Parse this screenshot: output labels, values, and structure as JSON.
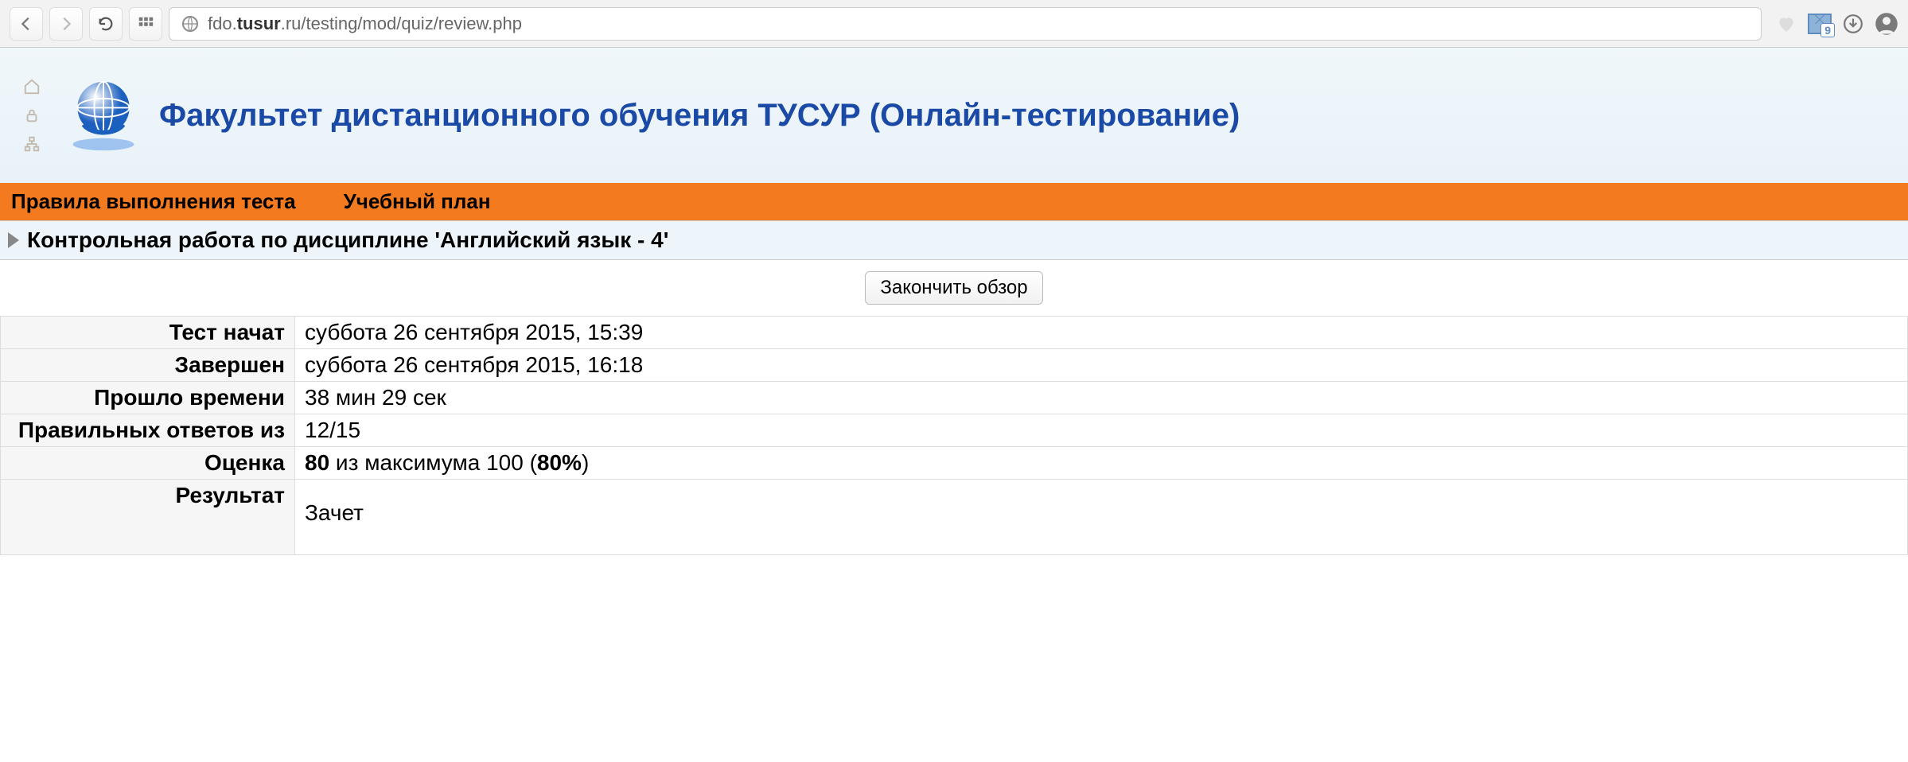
{
  "browser": {
    "url_pre": "fdo.",
    "url_host": "tusur",
    "url_post": ".ru/testing/mod/quiz/review.php",
    "mail_badge": "9"
  },
  "header": {
    "site_title": "Факультет дистанционного обучения ТУСУР (Онлайн-тестирование)"
  },
  "nav": {
    "rules": "Правила выполнения теста",
    "plan": "Учебный план"
  },
  "sub_header": "Контрольная работа по дисциплине 'Английский язык - 4'",
  "finish_button": "Закончить обзор",
  "summary": {
    "labels": {
      "started": "Тест начат",
      "finished": "Завершен",
      "time": "Прошло времени",
      "correct": "Правильных ответов из",
      "grade": "Оценка",
      "result": "Результат"
    },
    "values": {
      "started": "суббота 26 сентября 2015, 15:39",
      "finished": "суббота 26 сентября 2015, 16:18",
      "time": "38 мин 29 сек",
      "correct": "12/15",
      "grade_value": "80",
      "grade_mid": " из максимума 100 (",
      "grade_pct": "80%",
      "grade_close": ")",
      "result": "Зачет"
    }
  }
}
